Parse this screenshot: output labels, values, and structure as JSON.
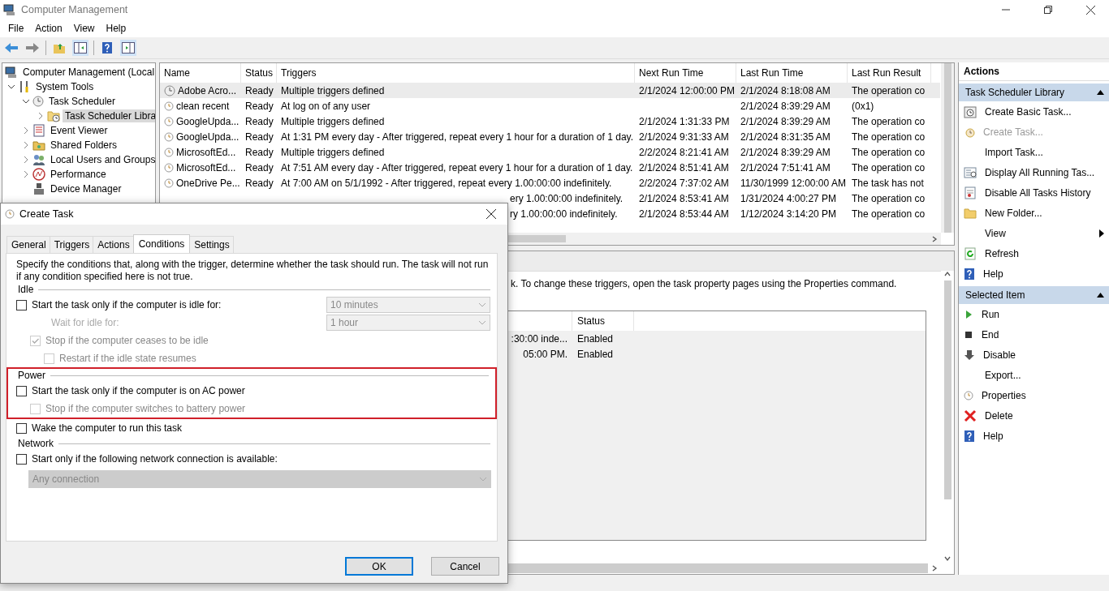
{
  "window": {
    "title": "Computer Management"
  },
  "menu": [
    "File",
    "Action",
    "View",
    "Help"
  ],
  "tree": [
    {
      "label": "Computer Management (Local",
      "expandable": false,
      "selected": false,
      "children": [
        {
          "label": "System Tools",
          "expandable": true,
          "expanded": true,
          "selected": false,
          "children": [
            {
              "label": "Task Scheduler",
              "expandable": true,
              "expanded": true,
              "selected": false,
              "children": [
                {
                  "label": "Task Scheduler Libra",
                  "expandable": true,
                  "expanded": false,
                  "selected": true
                }
              ]
            },
            {
              "label": "Event Viewer",
              "expandable": true,
              "expanded": false,
              "selected": false
            },
            {
              "label": "Shared Folders",
              "expandable": true,
              "expanded": false,
              "selected": false
            },
            {
              "label": "Local Users and Groups",
              "expandable": true,
              "expanded": false,
              "selected": false
            },
            {
              "label": "Performance",
              "expandable": true,
              "expanded": false,
              "selected": false
            },
            {
              "label": "Device Manager",
              "expandable": false,
              "selected": false
            }
          ]
        }
      ]
    }
  ],
  "task_list": {
    "columns": [
      "Name",
      "Status",
      "Triggers",
      "Next Run Time",
      "Last Run Time",
      "Last Run Result"
    ],
    "rows": [
      {
        "kind": "full",
        "selected": true,
        "name": "Adobe Acro...",
        "status": "Ready",
        "triggers": "Multiple triggers defined",
        "next_run": "2/1/2024 12:00:00 PM",
        "last_run": "2/1/2024 8:18:08 AM",
        "result": "The operation co"
      },
      {
        "kind": "full",
        "selected": false,
        "name": "clean recent",
        "status": "Ready",
        "triggers": "At log on of any user",
        "next_run": "",
        "last_run": "2/1/2024 8:39:29 AM",
        "result": "(0x1)"
      },
      {
        "kind": "full",
        "selected": false,
        "name": "GoogleUpda...",
        "status": "Ready",
        "triggers": "Multiple triggers defined",
        "next_run": "2/1/2024 1:31:33 PM",
        "last_run": "2/1/2024 8:39:29 AM",
        "result": "The operation co"
      },
      {
        "kind": "full",
        "selected": false,
        "name": "GoogleUpda...",
        "status": "Ready",
        "triggers": "At 1:31 PM every day - After triggered, repeat every 1 hour for a duration of 1 day.",
        "next_run": "2/1/2024 9:31:33 AM",
        "last_run": "2/1/2024 8:31:35 AM",
        "result": "The operation co"
      },
      {
        "kind": "full",
        "selected": false,
        "name": "MicrosoftEd...",
        "status": "Ready",
        "triggers": "Multiple triggers defined",
        "next_run": "2/2/2024 8:21:41 AM",
        "last_run": "2/1/2024 8:39:29 AM",
        "result": "The operation co"
      },
      {
        "kind": "full",
        "selected": false,
        "name": "MicrosoftEd...",
        "status": "Ready",
        "triggers": "At 7:51 AM every day - After triggered, repeat every 1 hour for a duration of 1 day.",
        "next_run": "2/1/2024 8:51:41 AM",
        "last_run": "2/1/2024 7:51:41 AM",
        "result": "The operation co"
      },
      {
        "kind": "full",
        "selected": false,
        "name": "OneDrive Pe...",
        "status": "Ready",
        "triggers": "At 7:00 AM on 5/1/1992 - After triggered, repeat every 1.00:00:00 indefinitely.",
        "next_run": "2/2/2024 7:37:02 AM",
        "last_run": "11/30/1999 12:00:00 AM",
        "result": "The task has not"
      },
      {
        "kind": "tail",
        "selected": false,
        "triggers": "ery 1.00:00:00 indefinitely.",
        "next_run": "2/1/2024 8:53:41 AM",
        "last_run": "1/31/2024 4:00:27 PM",
        "result": "The operation co"
      },
      {
        "kind": "tail",
        "selected": false,
        "triggers": "ry 1.00:00:00 indefinitely.",
        "next_run": "2/1/2024 8:53:44 AM",
        "last_run": "1/12/2024 3:14:20 PM",
        "result": "The operation co"
      }
    ]
  },
  "detail": {
    "text": "k.  To change these triggers, open the task property pages using the Properties command.",
    "columns": [
      "Status"
    ],
    "rows": [
      {
        "column_1": ":30:00 inde...",
        "status": "Enabled"
      },
      {
        "column_1": "05:00 PM.",
        "status": "Enabled"
      }
    ]
  },
  "actions": {
    "title": "Actions",
    "sections": [
      {
        "title": "Task Scheduler Library",
        "expanded": true,
        "items": [
          {
            "label": "Create Basic Task...",
            "disabled": false,
            "submenu": false
          },
          {
            "label": "Create Task...",
            "disabled": true,
            "submenu": false
          },
          {
            "label": "Import Task...",
            "disabled": false,
            "submenu": false
          },
          {
            "label": "Display All Running Tas...",
            "disabled": false,
            "submenu": false
          },
          {
            "label": "Disable All Tasks History",
            "disabled": false,
            "submenu": false
          },
          {
            "label": "New Folder...",
            "disabled": false,
            "submenu": false
          },
          {
            "label": "View",
            "disabled": false,
            "submenu": true
          },
          {
            "label": "Refresh",
            "disabled": false,
            "submenu": false
          },
          {
            "label": "Help",
            "disabled": false,
            "submenu": false
          }
        ]
      },
      {
        "title": "Selected Item",
        "expanded": true,
        "items": [
          {
            "label": "Run",
            "disabled": false,
            "submenu": false
          },
          {
            "label": "End",
            "disabled": false,
            "submenu": false
          },
          {
            "label": "Disable",
            "disabled": false,
            "submenu": false
          },
          {
            "label": "Export...",
            "disabled": false,
            "submenu": false
          },
          {
            "label": "Properties",
            "disabled": false,
            "submenu": false
          },
          {
            "label": "Delete",
            "disabled": false,
            "submenu": false
          },
          {
            "label": "Help",
            "disabled": false,
            "submenu": false
          }
        ]
      }
    ]
  },
  "dialog": {
    "title": "Create Task",
    "tabs": [
      {
        "label": "General",
        "selected": false
      },
      {
        "label": "Triggers",
        "selected": false
      },
      {
        "label": "Actions",
        "selected": false
      },
      {
        "label": "Conditions",
        "selected": true
      },
      {
        "label": "Settings",
        "selected": false
      }
    ],
    "description": "Specify the conditions that, along with the trigger, determine whether the task should run.  The task will not run  if any condition specified here is not true.",
    "sections": [
      {
        "title": "Idle",
        "highlighted": false,
        "rows": [
          {
            "kind": "checkbox",
            "label": "Start the task only if the computer is idle for:",
            "checked": false,
            "disabled": false,
            "dropdown": {
              "value": "10 minutes",
              "disabled": true
            },
            "children": [
              {
                "kind": "field",
                "label": "Wait for idle for:",
                "disabled": true,
                "dropdown": {
                  "value": "1 hour",
                  "disabled": true
                }
              },
              {
                "kind": "checkbox",
                "label": "Stop if the computer ceases to be idle",
                "checked": true,
                "disabled": true,
                "children": [
                  {
                    "kind": "checkbox",
                    "label": "Restart if the idle state resumes",
                    "checked": false,
                    "disabled": true
                  }
                ]
              }
            ]
          }
        ]
      },
      {
        "title": "Power",
        "highlighted": true,
        "rows": [
          {
            "kind": "checkbox",
            "label": "Start the task only if the computer is on AC power",
            "checked": false,
            "disabled": false,
            "children": [
              {
                "kind": "checkbox",
                "label": "Stop if the computer switches to battery power",
                "checked": false,
                "disabled": true
              }
            ]
          }
        ]
      },
      {
        "highlighted": false,
        "rows": [
          {
            "kind": "checkbox",
            "label": "Wake the computer to run this task",
            "checked": false,
            "disabled": false
          }
        ]
      },
      {
        "title": "Network",
        "highlighted": false,
        "rows": [
          {
            "kind": "checkbox",
            "label": "Start only if the following network connection is available:",
            "checked": false,
            "disabled": false
          },
          {
            "kind": "field",
            "disabled": true,
            "dropdown": {
              "value": "Any connection",
              "disabled": true
            }
          }
        ]
      }
    ],
    "buttons": [
      {
        "label": "OK",
        "default": true
      },
      {
        "label": "Cancel",
        "default": false
      }
    ]
  }
}
